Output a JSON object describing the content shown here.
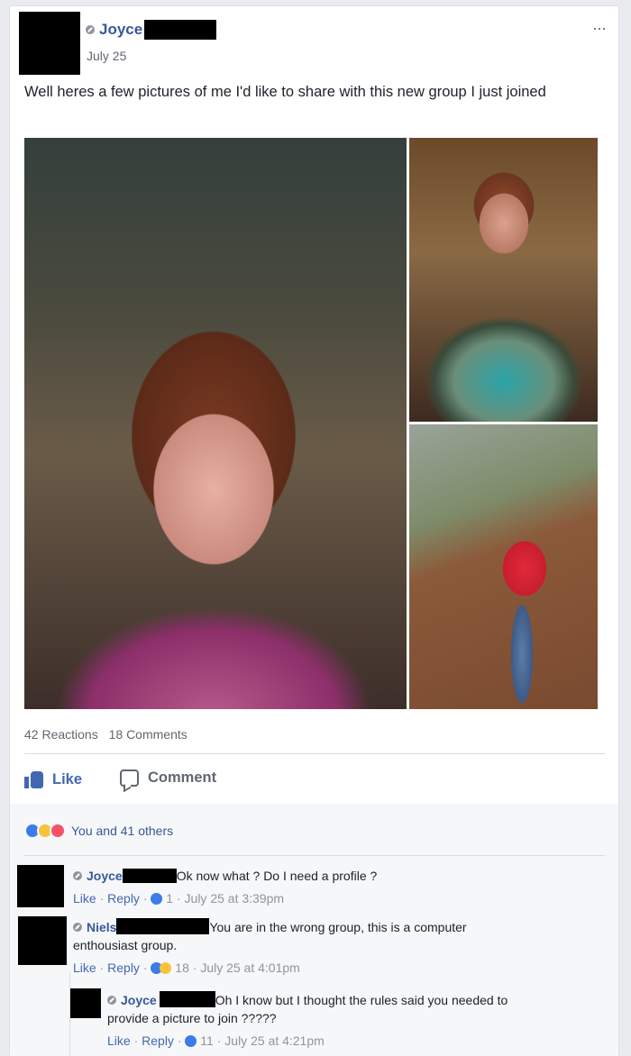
{
  "post": {
    "author": "Joyce",
    "date": "July 25",
    "menu_glyph": "···",
    "text": "Well heres a few pictures of me I'd like to share with this new group I just joined",
    "photos": [
      "main-selfie",
      "top-right-photo",
      "bottom-right-photo"
    ],
    "reactions_count": "42 Reactions",
    "comments_count": "18 Comments",
    "actions": {
      "like": "Like",
      "comment": "Comment"
    }
  },
  "reactions_summary": "You and 41 others",
  "comments": [
    {
      "author": "Joyce",
      "text": "Ok now what ? Do I need a profile ?",
      "like": "Like",
      "reply": "Reply",
      "reaction_count": "1",
      "time": "July 25 at 3:39pm"
    },
    {
      "author": "Niels",
      "text_line1": "You are in the wrong group, this is a computer",
      "text_line2": "enthousiast group.",
      "like": "Like",
      "reply": "Reply",
      "reaction_count": "18",
      "time": "July 25 at 4:01pm"
    },
    {
      "author": "Joyce",
      "text_line1": "Oh I know but I thought the rules said you needed to",
      "text_line2": "provide a picture to join ?????",
      "like": "Like",
      "reply": "Reply",
      "reaction_count": "11",
      "time": "July 25 at 4:21pm"
    }
  ],
  "colors": {
    "link": "#365899",
    "accent": "#4267b2",
    "muted": "#90949c"
  }
}
